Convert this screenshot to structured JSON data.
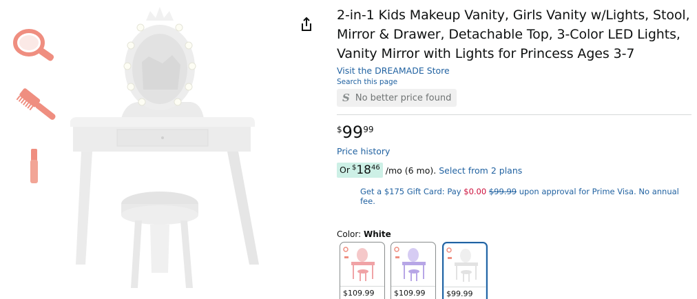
{
  "product": {
    "title": "2-in-1 Kids Makeup Vanity, Girls Vanity w/Lights, Stool, Mirror & Drawer, Detachable Top, 3-Color LED Lights, Vanity Mirror with Lights for Princess Ages 3-7",
    "store_link": "Visit the DREAMADE Store",
    "search_page": "Search this page",
    "price_check": {
      "logo": "S",
      "text": "No better price found"
    },
    "price": {
      "symbol": "$",
      "whole": "99",
      "fraction": "99"
    },
    "price_history": "Price history",
    "monthly": {
      "prefix": "Or",
      "symbol": "$",
      "whole": "18",
      "fraction": "46",
      "per": "/mo (6 mo).",
      "plans": "Select from 2 plans"
    },
    "gift_card": {
      "text1": "Get a $175 Gift Card: Pay ",
      "pay": "$0.00",
      "old": "$99.99",
      "text2": " upon approval for Prime Visa. No annual fee."
    }
  },
  "color": {
    "label": "Color:",
    "selected": "White",
    "options": [
      {
        "name": "Pink",
        "price": "$109.99",
        "tone": "#f0a3a6"
      },
      {
        "name": "Purple",
        "price": "$109.99",
        "tone": "#b7a6e6"
      },
      {
        "name": "White",
        "price": "$99.99",
        "tone": "#e9e9e9"
      }
    ]
  },
  "icons": {
    "share": "share-icon",
    "price_logo": "s-logo-icon"
  },
  "colors": {
    "link": "#2162a1",
    "text": "#0f1111",
    "deal_red": "#cc0c39",
    "selected_border": "#2162a1"
  }
}
